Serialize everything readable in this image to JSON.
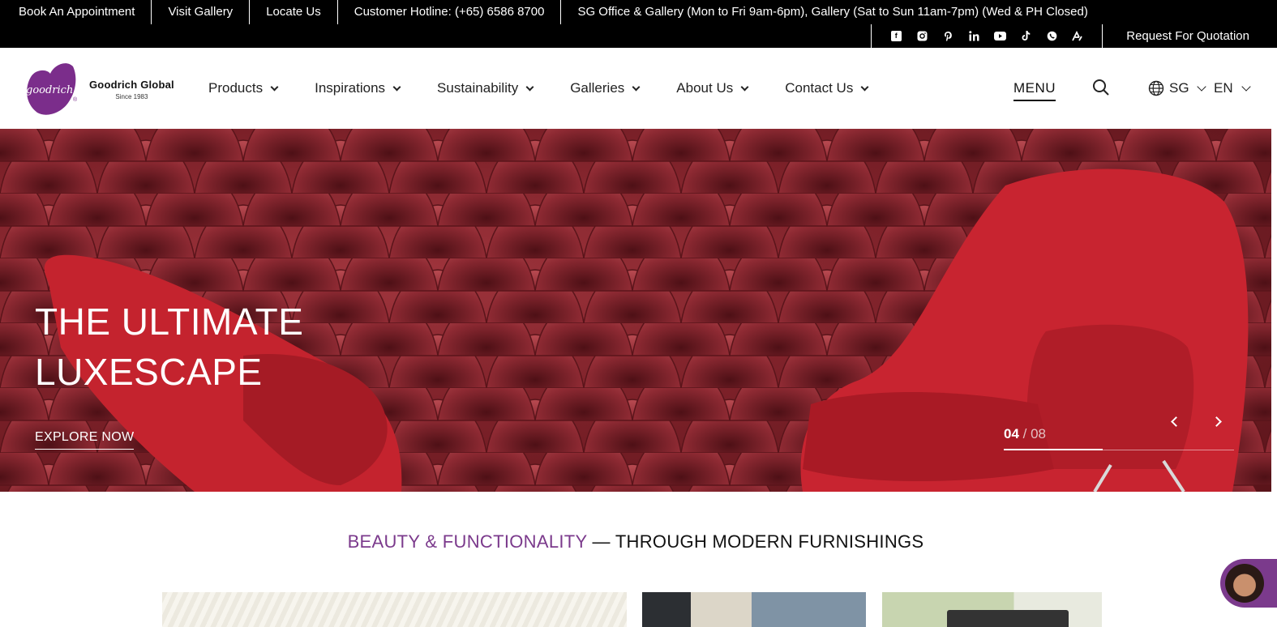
{
  "topbar": {
    "links": [
      "Book An Appointment",
      "Visit Gallery",
      "Locate Us",
      "Customer Hotline: (+65) 6586 8700",
      "SG Office & Gallery (Mon to Fri 9am-6pm), Gallery (Sat to Sun 11am-7pm) (Wed & PH Closed)"
    ],
    "social_icons": [
      "facebook-icon",
      "instagram-icon",
      "pinterest-icon",
      "linkedin-icon",
      "youtube-icon",
      "tiktok-icon",
      "whatsapp-icon",
      "tool-icon"
    ],
    "quotation": "Request For Quotation"
  },
  "brand": {
    "logo_word": "goodrich",
    "name": "Goodrich Global",
    "since": "Since 1983",
    "color": "#7b2d8b"
  },
  "nav": {
    "items": [
      "Products",
      "Inspirations",
      "Sustainability",
      "Galleries",
      "About Us",
      "Contact Us"
    ],
    "menu_label": "MENU",
    "region": "SG",
    "language": "EN"
  },
  "hero": {
    "title_line1": "THE ULTIMATE",
    "title_line2": "LUXESCAPE",
    "cta": "EXPLORE NOW",
    "slide_current": "04",
    "slide_total": "/ 08",
    "progress": 0.43
  },
  "section": {
    "heading_accent": "BEAUTY & FUNCTIONALITY",
    "heading_rest": " — THROUGH MODERN FURNISHINGS",
    "accent_color": "#7b3a8c"
  }
}
